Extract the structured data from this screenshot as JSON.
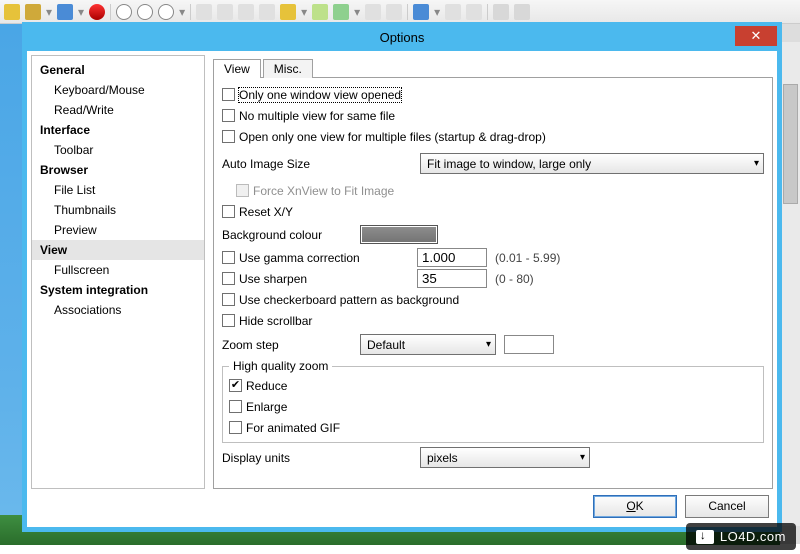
{
  "dialog": {
    "title": "Options"
  },
  "sidebar": {
    "groups": [
      {
        "label": "General",
        "items": [
          {
            "label": "Keyboard/Mouse"
          },
          {
            "label": "Read/Write"
          }
        ]
      },
      {
        "label": "Interface",
        "items": [
          {
            "label": "Toolbar"
          }
        ]
      },
      {
        "label": "Browser",
        "items": [
          {
            "label": "File List"
          },
          {
            "label": "Thumbnails"
          },
          {
            "label": "Preview"
          }
        ]
      },
      {
        "label": "View",
        "selected": true,
        "items": [
          {
            "label": "Fullscreen"
          }
        ]
      },
      {
        "label": "System integration",
        "items": [
          {
            "label": "Associations"
          }
        ]
      }
    ]
  },
  "tabs": [
    {
      "label": "View",
      "active": true
    },
    {
      "label": "Misc."
    }
  ],
  "view": {
    "opts": [
      {
        "label": "Only one window view opened",
        "checked": false
      },
      {
        "label": "No multiple view for same file",
        "checked": false
      },
      {
        "label": "Open only one view for multiple files (startup & drag-drop)",
        "checked": false
      }
    ],
    "auto_size_label": "Auto Image Size",
    "auto_size_value": "Fit image to window, large only",
    "force_fit": {
      "label": "Force XnView to Fit Image",
      "disabled": true
    },
    "reset_xy": {
      "label": "Reset X/Y",
      "checked": false
    },
    "bg_label": "Background colour",
    "bg_color": "#808080",
    "gamma": {
      "label": "Use gamma correction",
      "value": "1.000",
      "hint": "(0.01 - 5.99)"
    },
    "sharpen": {
      "label": "Use sharpen",
      "value": "35",
      "hint": "(0 - 80)"
    },
    "checker": {
      "label": "Use checkerboard pattern as background"
    },
    "hidescroll": {
      "label": "Hide scrollbar"
    },
    "zoomstep_label": "Zoom step",
    "zoomstep_value": "Default",
    "hq": {
      "legend": "High quality zoom",
      "reduce": {
        "label": "Reduce",
        "checked": true
      },
      "enlarge": {
        "label": "Enlarge"
      },
      "gif": {
        "label": "For animated GIF"
      }
    },
    "units_label": "Display units",
    "units_value": "pixels"
  },
  "buttons": {
    "ok": "OK",
    "cancel": "Cancel"
  },
  "watermark": "LO4D.com"
}
